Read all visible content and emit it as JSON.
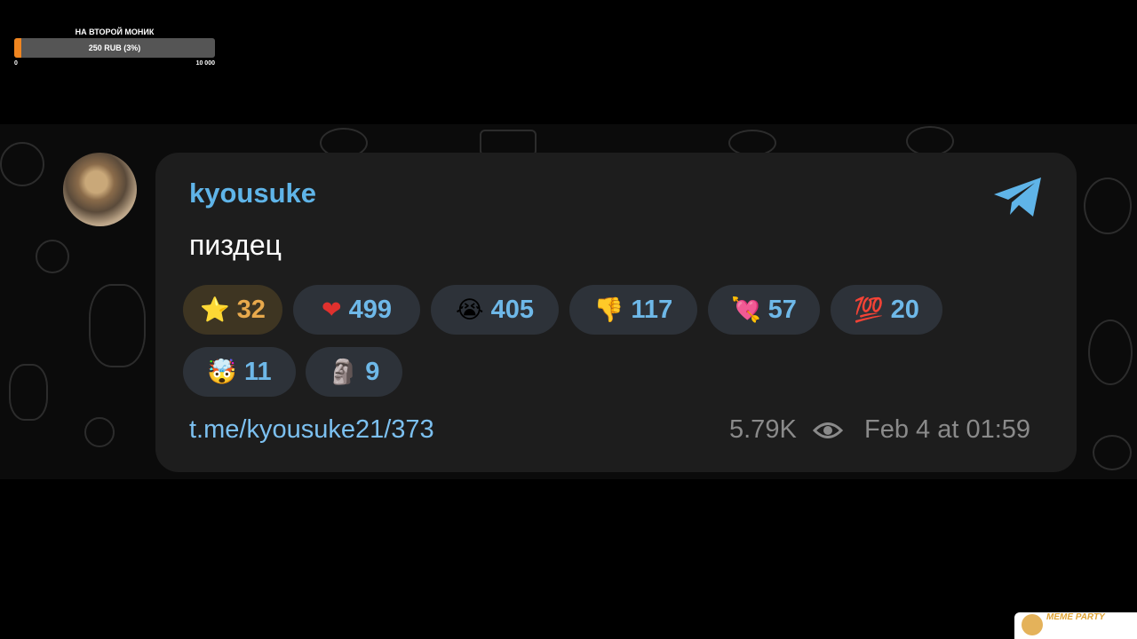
{
  "goal": {
    "title": "НА ВТОРОЙ МОНИК",
    "amount_text": "250 RUB (3%)",
    "progress_fraction": 0.03,
    "min": "0",
    "max": "10 000",
    "accent": "#f0851f"
  },
  "message": {
    "author": "kyousuke",
    "text": "пиздец",
    "link": "t.me/kyousuke21/373",
    "views": "5.79K",
    "date": "Feb 4 at 01:59",
    "author_color": "#5fb4e8",
    "app_icon": "telegram-plane-icon"
  },
  "reactions": [
    {
      "emoji": "⭐",
      "icon": "star-icon",
      "count": "32",
      "paid": true
    },
    {
      "emoji": "❤",
      "icon": "heart-icon",
      "count": "499"
    },
    {
      "emoji": "😭",
      "icon": "crying-face-icon",
      "count": "405"
    },
    {
      "emoji": "👎",
      "icon": "thumbs-down-icon",
      "count": "117"
    },
    {
      "emoji": "💘",
      "icon": "heart-arrow-icon",
      "count": "57"
    },
    {
      "emoji": "💯",
      "icon": "hundred-icon",
      "count": "20"
    },
    {
      "emoji": "🤯",
      "icon": "exploding-head-icon",
      "count": "11"
    },
    {
      "emoji": "🗿",
      "icon": "moai-icon",
      "count": "9"
    }
  ],
  "watermark": {
    "text": "MEME PARTY"
  }
}
